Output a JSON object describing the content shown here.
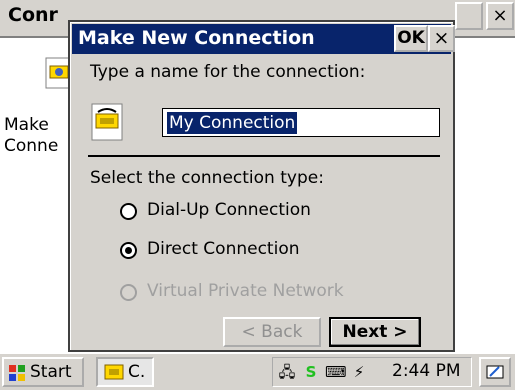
{
  "background_window": {
    "title_partial": "Conr",
    "close_glyph": "×",
    "icon_label_line1": "Make",
    "icon_label_line2": "Conne"
  },
  "dialog": {
    "title": "Make New Connection",
    "ok_label": "OK",
    "close_glyph": "×",
    "name_prompt": "Type a name for the connection:",
    "name_value": "My Connection",
    "type_prompt": "Select the connection type:",
    "options": [
      {
        "label": "Dial-Up Connection",
        "checked": false,
        "enabled": true
      },
      {
        "label": "Direct Connection",
        "checked": true,
        "enabled": true
      },
      {
        "label": "Virtual Private Network",
        "checked": false,
        "enabled": false
      }
    ],
    "back_label": "< Back",
    "next_label": "Next >"
  },
  "taskbar": {
    "start_label": "Start",
    "task_label": "C.",
    "clock": "2:44 PM"
  },
  "colors": {
    "titlebar": "#08246b",
    "face": "#d6d3ce",
    "selection": "#08246b"
  }
}
